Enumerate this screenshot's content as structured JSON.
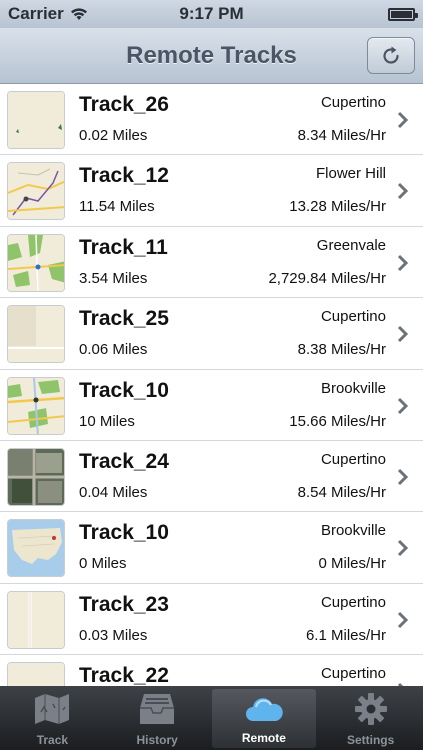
{
  "status_bar": {
    "carrier": "Carrier",
    "time": "9:17 PM",
    "battery_level": 1.0
  },
  "nav": {
    "title": "Remote Tracks",
    "refresh_icon": "refresh-icon"
  },
  "tracks": [
    {
      "name": "Track_26",
      "location": "Cupertino",
      "distance": "0.02 Miles",
      "speed": "8.34 Miles/Hr",
      "thumb": "plain-map"
    },
    {
      "name": "Track_12",
      "location": "Flower Hill",
      "distance": "11.54 Miles",
      "speed": "13.28 Miles/Hr",
      "thumb": "route-map"
    },
    {
      "name": "Track_11",
      "location": "Greenvale",
      "distance": "3.54 Miles",
      "speed": "2,729.84 Miles/Hr",
      "thumb": "green-map"
    },
    {
      "name": "Track_25",
      "location": "Cupertino",
      "distance": "0.06 Miles",
      "speed": "8.38 Miles/Hr",
      "thumb": "plain-map"
    },
    {
      "name": "Track_10",
      "location": "Brookville",
      "distance": "10 Miles",
      "speed": "15.66 Miles/Hr",
      "thumb": "road-map"
    },
    {
      "name": "Track_24",
      "location": "Cupertino",
      "distance": "0.04 Miles",
      "speed": "8.54 Miles/Hr",
      "thumb": "satellite-map"
    },
    {
      "name": "Track_10",
      "location": "Brookville",
      "distance": "0 Miles",
      "speed": "0 Miles/Hr",
      "thumb": "us-map"
    },
    {
      "name": "Track_23",
      "location": "Cupertino",
      "distance": "0.03 Miles",
      "speed": "6.1 Miles/Hr",
      "thumb": "plain-map"
    },
    {
      "name": "Track_22",
      "location": "Cupertino",
      "distance": "",
      "speed": "",
      "thumb": "plain-map"
    }
  ],
  "tabs": [
    {
      "label": "Track",
      "icon": "map-icon",
      "active": false
    },
    {
      "label": "History",
      "icon": "archive-icon",
      "active": false
    },
    {
      "label": "Remote",
      "icon": "cloud-icon",
      "active": true
    },
    {
      "label": "Settings",
      "icon": "gear-icon",
      "active": false
    }
  ]
}
